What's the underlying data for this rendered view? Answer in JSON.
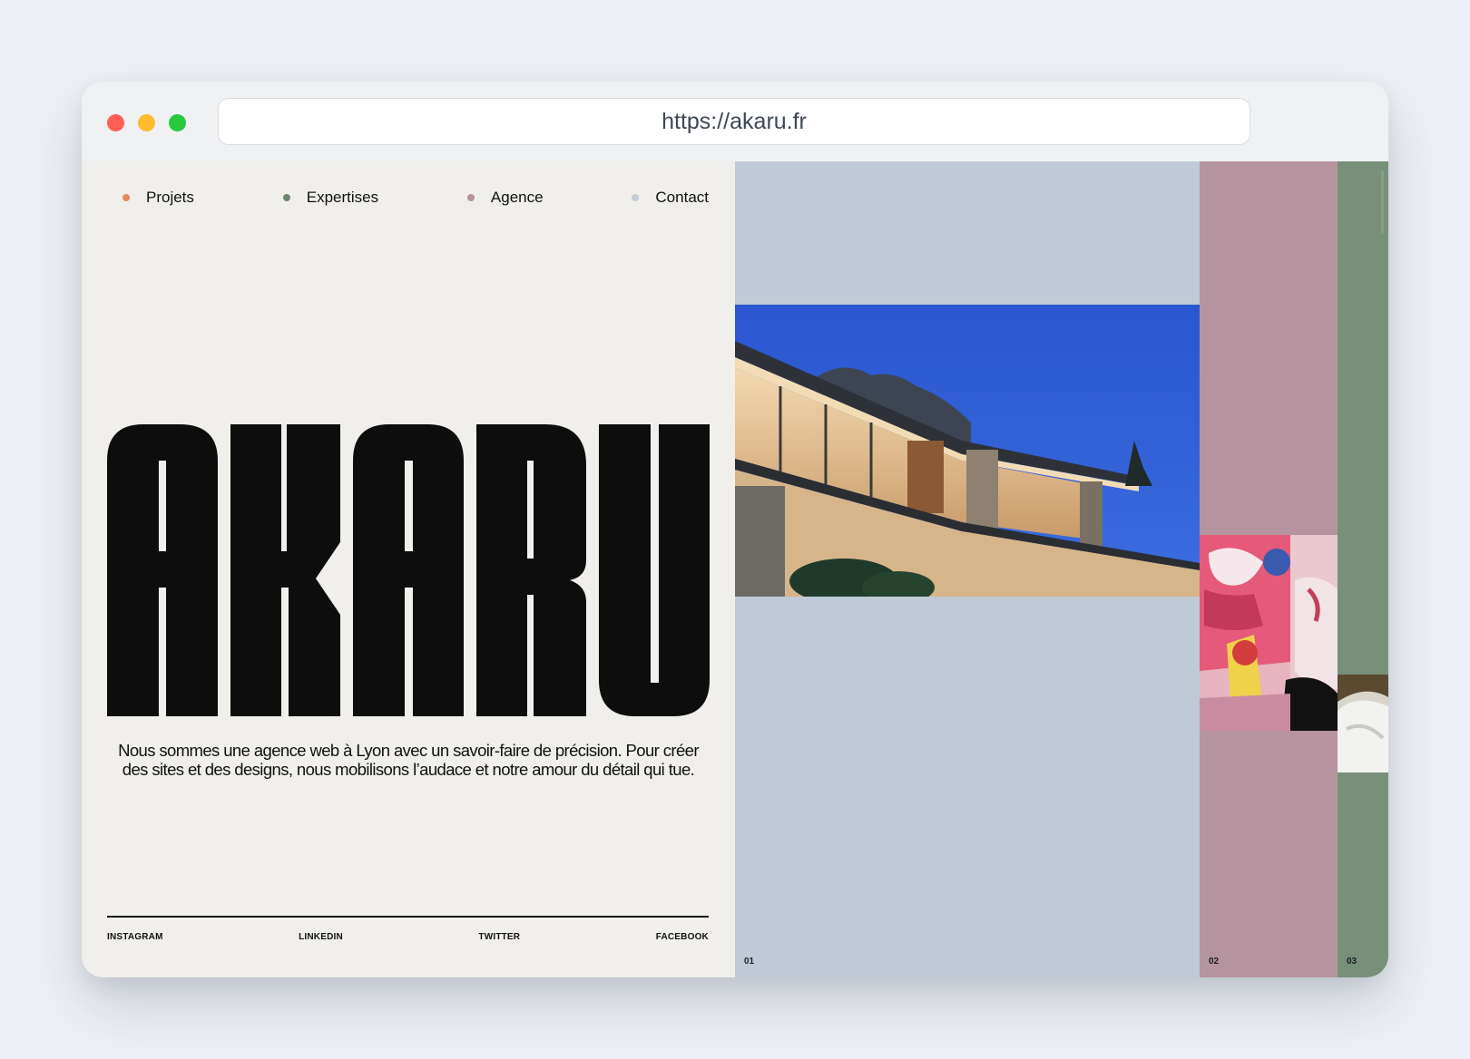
{
  "browser": {
    "url": "https://akaru.fr"
  },
  "nav": {
    "items": [
      {
        "label": "Projets",
        "dot_color": "#e0895f"
      },
      {
        "label": "Expertises",
        "dot_color": "#6e8670"
      },
      {
        "label": "Agence",
        "dot_color": "#b5939f"
      },
      {
        "label": "Contact",
        "dot_color": "#c3ccd8"
      }
    ]
  },
  "hero": {
    "logo_text": "AKARU",
    "tagline": "Nous sommes une agence web à Lyon avec un savoir-faire de précision. Pour créer des sites et des designs, nous mobilisons l’audace et notre amour du détail qui tue."
  },
  "socials": [
    "INSTAGRAM",
    "LINKEDIN",
    "TWITTER",
    "FACEBOOK"
  ],
  "projects": [
    {
      "number": "01",
      "bg_color": "#bfcad6"
    },
    {
      "number": "02",
      "bg_color": "#b5939f"
    },
    {
      "number": "03",
      "bg_color": "#788f79"
    }
  ],
  "colors": {
    "page_bg": "#edf0f4",
    "site_bg": "#f0efeb",
    "text": "#111111"
  }
}
